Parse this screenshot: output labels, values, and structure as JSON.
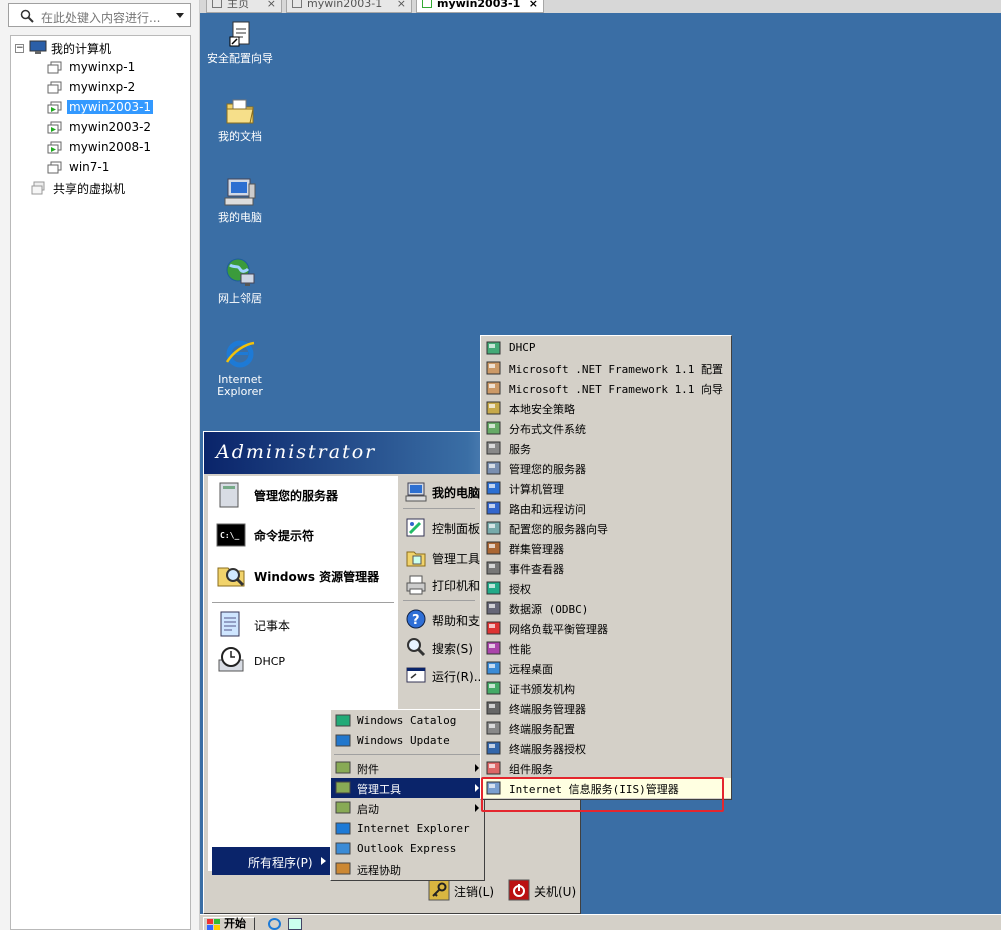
{
  "sidebar": {
    "search_placeholder": "在此处键入内容进行...",
    "tree": {
      "root": "我的计算机",
      "vms": [
        "mywinxp-1",
        "mywinxp-2",
        "mywin2003-1",
        "mywin2003-2",
        "mywin2008-1",
        "win7-1"
      ],
      "selected": "mywin2003-1",
      "shared": "共享的虚拟机"
    }
  },
  "tabs": [
    {
      "label": "主页",
      "close": "×"
    },
    {
      "label": "mywin2003-1",
      "close": "×"
    },
    {
      "label": "mywin2003-1",
      "close": "×"
    }
  ],
  "desktop_icons": [
    {
      "label": "安全配置向导",
      "icon": "wizard-icon"
    },
    {
      "label": "我的文档",
      "icon": "folder-icon"
    },
    {
      "label": "我的电脑",
      "icon": "computer-icon"
    },
    {
      "label": "网上邻居",
      "icon": "network-icon"
    },
    {
      "label": "Internet Explorer",
      "icon": "ie-icon"
    }
  ],
  "start_menu": {
    "user": "Administrator",
    "left_items": [
      "管理您的服务器",
      "命令提示符",
      "Windows 资源管理器",
      "记事本",
      "DHCP"
    ],
    "right_items": [
      "我的电脑",
      "控制面板",
      "管理工具",
      "打印机和传真",
      "帮助和支持",
      "搜索(S)",
      "运行(R)..."
    ],
    "all_programs": "所有程序(P)",
    "logoff": "注销(L)",
    "shutdown": "关机(U)"
  },
  "programs_menu": [
    "Windows Catalog",
    "Windows Update",
    "附件",
    "管理工具",
    "启动",
    "Internet Explorer",
    "Outlook Express",
    "远程协助"
  ],
  "programs_highlight": "管理工具",
  "admin_tools_menu": [
    "DHCP",
    "Microsoft .NET Framework 1.1 配置",
    "Microsoft .NET Framework 1.1 向导",
    "本地安全策略",
    "分布式文件系统",
    "服务",
    "管理您的服务器",
    "计算机管理",
    "路由和远程访问",
    "配置您的服务器向导",
    "群集管理器",
    "事件查看器",
    "授权",
    "数据源 (ODBC)",
    "网络负载平衡管理器",
    "性能",
    "远程桌面",
    "证书颁发机构",
    "终端服务管理器",
    "终端服务配置",
    "终端服务器授权",
    "组件服务",
    "Internet 信息服务(IIS)管理器"
  ],
  "taskbar": {
    "start": "开始"
  },
  "colors": {
    "desktop": "#3a6ea5",
    "highlight": "#0a246a",
    "callout": "#e4262e",
    "tree_selected": "#3399ff"
  }
}
